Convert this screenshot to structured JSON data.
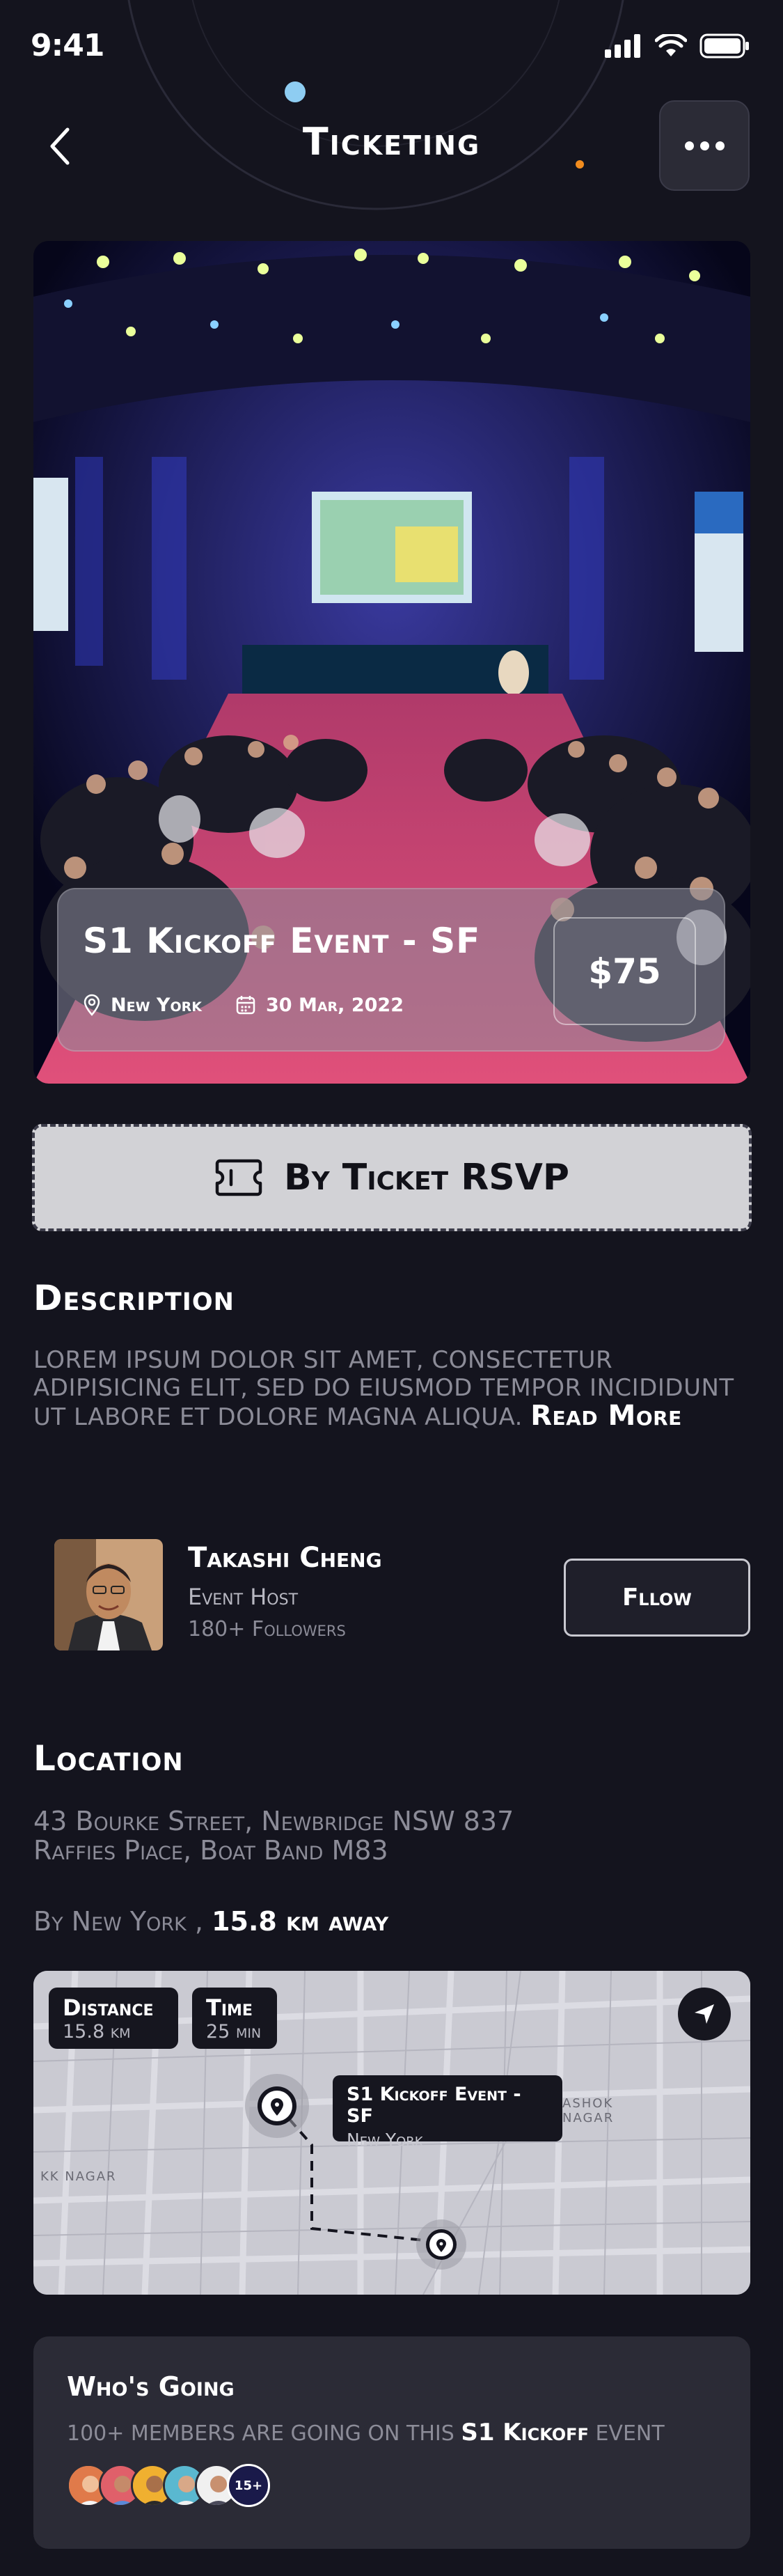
{
  "status_bar": {
    "time": "9:41"
  },
  "header": {
    "title": "Ticketing"
  },
  "event": {
    "title": "S1 Kickoff Event - SF",
    "location": "New York",
    "date": "30 Mar, 2022",
    "price": "$75"
  },
  "rsvp": {
    "label": "By Ticket RSVP"
  },
  "description": {
    "title": "Description",
    "text": "Lorem ipsum dolor sit amet, consectetur adipisicing elit, sed do eiusmod tempor incididunt ut labore et dolore magna aliqua. ",
    "read_more": "Read More"
  },
  "host": {
    "name": "Takashi Cheng",
    "role": "Event Host",
    "followers": "180+ Followers",
    "follow_label": "Fllow"
  },
  "location": {
    "title": "Location",
    "address_line1": "43 Bourke Street, Newbridge NSW 837",
    "address_line2": "Raffies Piace, Boat Band M83",
    "by_text": "By New York ,",
    "distance_text": "15.8 km away"
  },
  "map": {
    "distance_label": "Distance",
    "distance_value": "15.8 km",
    "time_label": "Time",
    "time_value": "25 min",
    "tooltip_title": "S1 Kickoff Event - SF",
    "tooltip_sub": "New York",
    "area_labels": [
      "KK NAGAR",
      "ASHOK NAGAR"
    ]
  },
  "going": {
    "title": "Who's Going",
    "text_prefix": "100+ members are going on this",
    "highlight": "S1 Kickoff",
    "text_suffix": "event",
    "more_count": "15+"
  },
  "colors": {
    "background": "#14141e",
    "card": "#2b2b36",
    "accent_blue": "#8ecdf2",
    "accent_orange": "#f28c1e"
  }
}
